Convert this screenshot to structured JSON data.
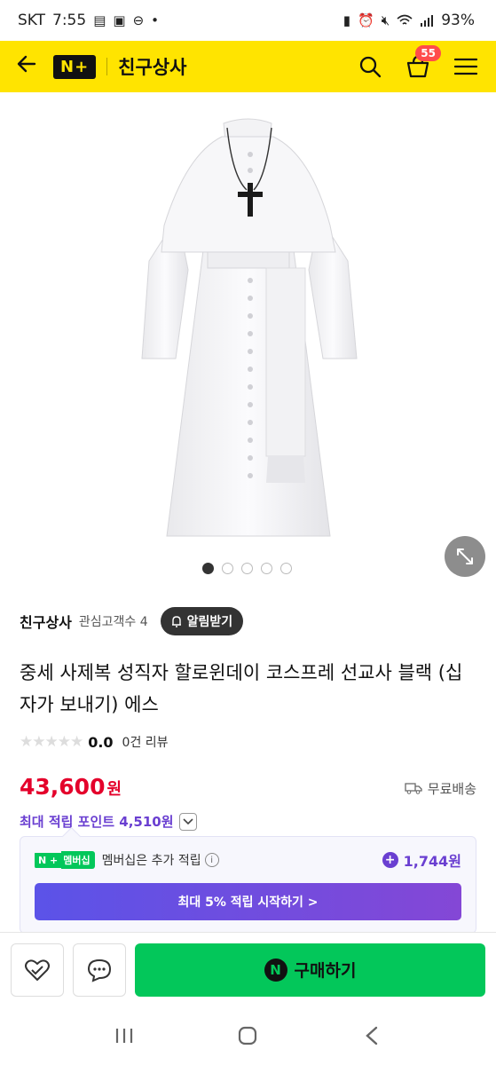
{
  "status_bar": {
    "carrier": "SKT",
    "time": "7:55",
    "battery": "93%"
  },
  "header": {
    "logo": "N+",
    "store_name": "친구상사",
    "cart_count": "55"
  },
  "gallery": {
    "image_count": 5,
    "active_index": 0
  },
  "product": {
    "store_link": "친구상사",
    "fan_count": "관심고객수 4",
    "alarm_label": "알림받기",
    "title": "중세 사제복 성직자 할로윈데이 코스프레 선교사 블랙 (십자가 보내기) 에스",
    "stars": "★★★★★",
    "rating": "0.0",
    "review_count": "0건 리뷰",
    "price": "43,600",
    "price_unit": "원",
    "shipping": "무료배송",
    "max_points": "최대 적립 포인트 4,510원"
  },
  "membership": {
    "badge_n": "N +",
    "badge_label": "멤버십",
    "text": "멤버십은 추가 적립",
    "points": "1,744원",
    "cta": "최대 5% 적립 시작하기 >"
  },
  "bottom": {
    "buy_label": "구매하기",
    "buy_icon": "N"
  },
  "colors": {
    "header_bg": "#ffe400",
    "price": "#e4002b",
    "points": "#6a3fd1",
    "buy_button": "#03c75a"
  }
}
